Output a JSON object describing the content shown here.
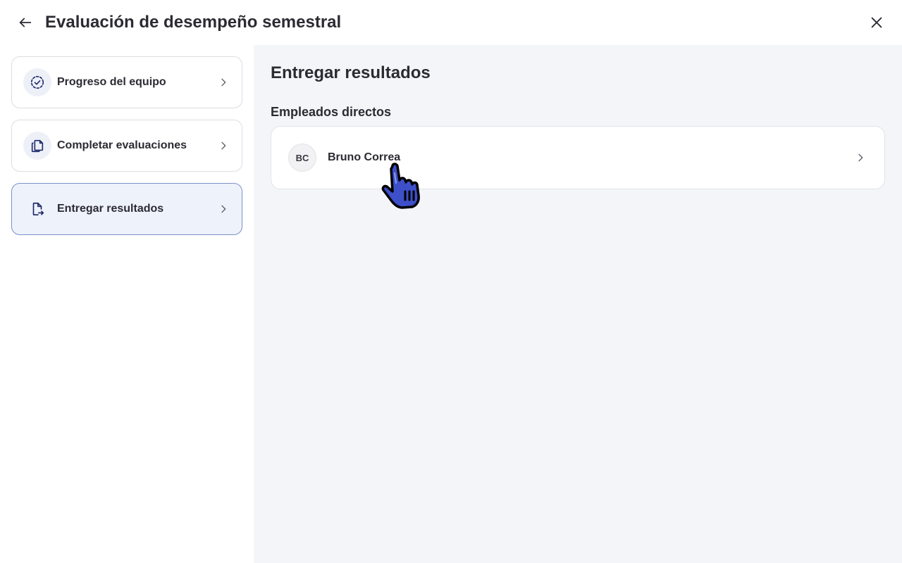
{
  "header": {
    "title": "Evaluación de desempeño semestral",
    "back_icon": "arrow-left-icon",
    "close_icon": "close-icon"
  },
  "sidebar": {
    "items": [
      {
        "label": "Progreso del equipo",
        "icon": "dashed-circle-check-icon",
        "active": false
      },
      {
        "label": "Completar evaluaciones",
        "icon": "copy-documents-icon",
        "active": false
      },
      {
        "label": "Entregar resultados",
        "icon": "file-export-icon",
        "active": true
      }
    ]
  },
  "main": {
    "title": "Entregar resultados",
    "section_label": "Empleados directos",
    "employees": [
      {
        "initials": "BC",
        "name": "Bruno Correa"
      }
    ]
  },
  "colors": {
    "accent": "#1f2a6b",
    "active_bg": "#eef2fb",
    "active_border": "#7d8fc6",
    "main_bg": "#f4f5f8",
    "cursor_fill": "#3d4fc9"
  }
}
